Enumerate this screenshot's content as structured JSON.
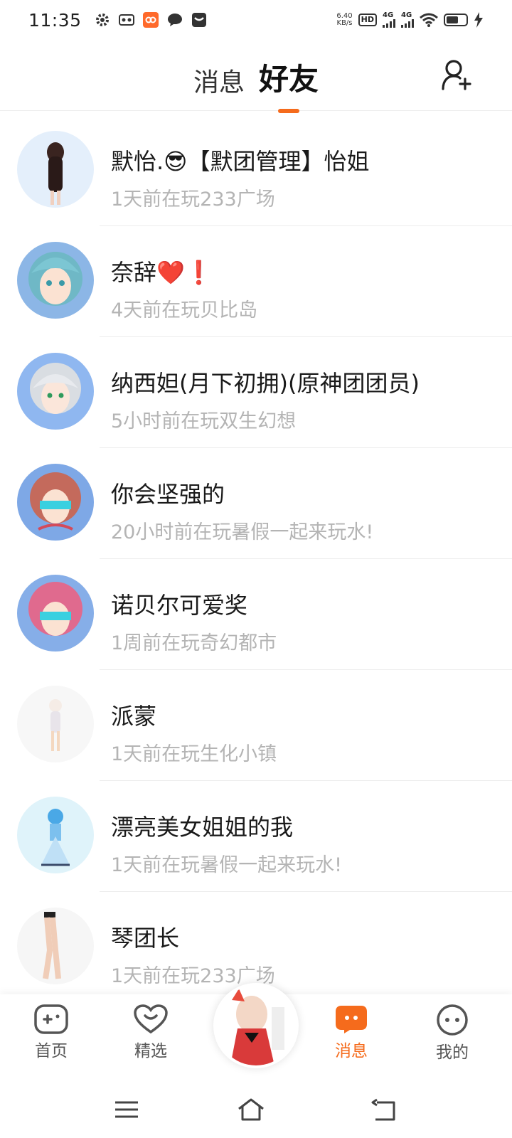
{
  "status_bar": {
    "time": "11:35",
    "net_speed_value": "6.40",
    "net_speed_unit": "KB/s",
    "hd": "HD",
    "signal1": "4G",
    "signal2": "4G",
    "battery_level": 0.6
  },
  "header": {
    "tab_messages": "消息",
    "tab_friends": "好友",
    "accent_color": "#f56b1c"
  },
  "friends": [
    {
      "name": "默怡.😎【默团管理】怡姐",
      "status": "1天前在玩233广场",
      "avatar_bg": "#e4effb"
    },
    {
      "name": "奈辞❤️❗",
      "status": "4天前在玩贝比岛",
      "avatar_bg": "#8cb6e6"
    },
    {
      "name": "纳西妲(月下初拥)(原神团团员)",
      "status": "5小时前在玩双生幻想",
      "avatar_bg": "#8fb7f0"
    },
    {
      "name": "你会坚强的",
      "status": "20小时前在玩暑假一起来玩水!",
      "avatar_bg": "#7ea8e6"
    },
    {
      "name": "诺贝尔可爱奖",
      "status": "1周前在玩奇幻都市",
      "avatar_bg": "#86aee8"
    },
    {
      "name": "派蒙",
      "status": "1天前在玩生化小镇",
      "avatar_bg": "#f7f7f7"
    },
    {
      "name": "漂亮美女姐姐的我",
      "status": "1天前在玩暑假一起来玩水!",
      "avatar_bg": "#dff3fa"
    },
    {
      "name": "琴团长",
      "status": "1天前在玩233广场",
      "avatar_bg": "#f6f6f6"
    }
  ],
  "bottom_nav": {
    "home": "首页",
    "featured": "精选",
    "messages": "消息",
    "mine": "我的"
  }
}
